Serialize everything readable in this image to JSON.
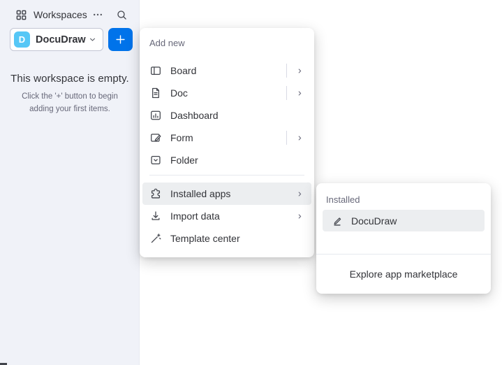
{
  "colors": {
    "accent_blue": "#0073ea",
    "workspace_avatar_blue": "#56c7f6",
    "sidebar_background": "#f0f2f8",
    "row_highlight": "#eceef0",
    "text_primary": "#323338",
    "text_secondary": "#676879"
  },
  "icons": [
    "grid-icon",
    "ellipsis-icon",
    "search-icon",
    "chevron-down-icon",
    "plus-icon",
    "chevron-right-icon"
  ],
  "sidebar": {
    "workspaces_label": "Workspaces",
    "workspace_selector": {
      "avatar_letter": "D",
      "name": "DocuDraw"
    },
    "empty_state": {
      "title": "This workspace is empty.",
      "subtitle_line1": "Click the '+' button to begin",
      "subtitle_line2": "adding your first items."
    }
  },
  "add_new_menu": {
    "title": "Add new",
    "items": [
      {
        "label": "Board",
        "icon": "board-icon",
        "submenu": true,
        "split": true,
        "highlighted": false,
        "divider_before": false
      },
      {
        "label": "Doc",
        "icon": "doc-icon",
        "submenu": true,
        "split": true,
        "highlighted": false,
        "divider_before": false
      },
      {
        "label": "Dashboard",
        "icon": "dashboard-icon",
        "submenu": false,
        "split": false,
        "highlighted": false,
        "divider_before": false
      },
      {
        "label": "Form",
        "icon": "form-icon",
        "submenu": true,
        "split": true,
        "highlighted": false,
        "divider_before": false
      },
      {
        "label": "Folder",
        "icon": "folder-icon",
        "submenu": false,
        "split": false,
        "highlighted": false,
        "divider_before": false
      },
      {
        "label": "Installed apps",
        "icon": "puzzle-icon",
        "submenu": true,
        "split": false,
        "highlighted": true,
        "divider_before": true
      },
      {
        "label": "Import data",
        "icon": "import-icon",
        "submenu": true,
        "split": false,
        "highlighted": false,
        "divider_before": false
      },
      {
        "label": "Template center",
        "icon": "wand-icon",
        "submenu": false,
        "split": false,
        "highlighted": false,
        "divider_before": false
      }
    ]
  },
  "installed_apps_submenu": {
    "title": "Installed",
    "items": [
      {
        "label": "DocuDraw",
        "icon": "pencil-icon",
        "highlighted": true
      }
    ],
    "footer_link": "Explore app marketplace"
  }
}
